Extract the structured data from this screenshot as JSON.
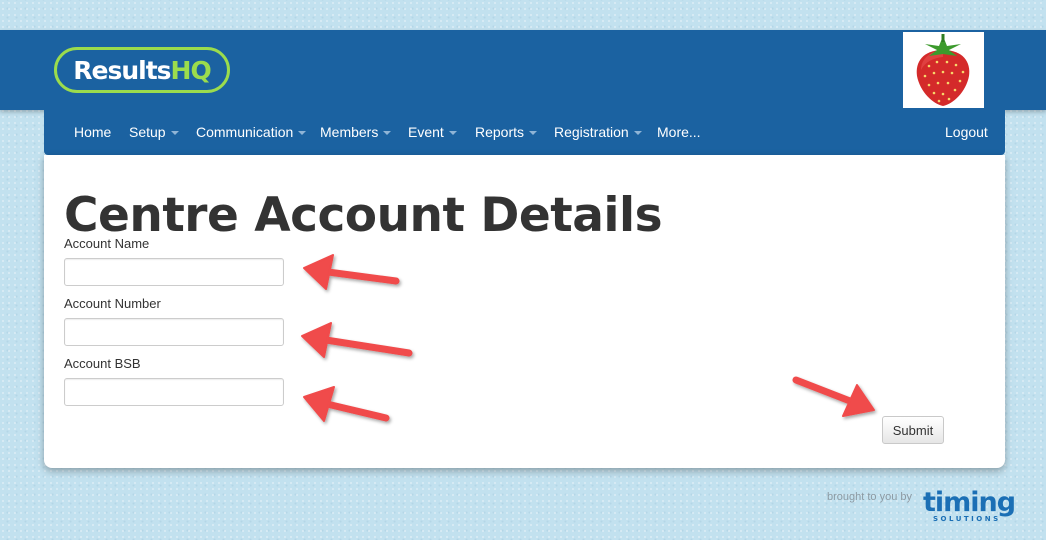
{
  "header": {
    "logo_part1": "Results",
    "logo_part2": "HQ",
    "brand_image": "strawberry-logo"
  },
  "nav": {
    "items": [
      {
        "label": "Home",
        "dropdown": false
      },
      {
        "label": "Setup",
        "dropdown": true
      },
      {
        "label": "Communication",
        "dropdown": true
      },
      {
        "label": "Members",
        "dropdown": true
      },
      {
        "label": "Event",
        "dropdown": true
      },
      {
        "label": "Reports",
        "dropdown": true
      },
      {
        "label": "Registration",
        "dropdown": true
      },
      {
        "label": "More...",
        "dropdown": false
      }
    ],
    "logout_label": "Logout"
  },
  "page": {
    "title": "Centre Account Details",
    "fields": [
      {
        "label": "Account Name",
        "value": ""
      },
      {
        "label": "Account Number",
        "value": ""
      },
      {
        "label": "Account BSB",
        "value": ""
      }
    ],
    "submit_label": "Submit"
  },
  "footer": {
    "brought_by": "brought to you by",
    "brand_main": "timing",
    "brand_sub": "SOLUTIONS"
  },
  "colors": {
    "header_bg": "#1b62a1",
    "logo_accent": "#9bdc4d",
    "annotation_arrow": "#f04b4b",
    "page_bg": "#c2e1ef"
  }
}
